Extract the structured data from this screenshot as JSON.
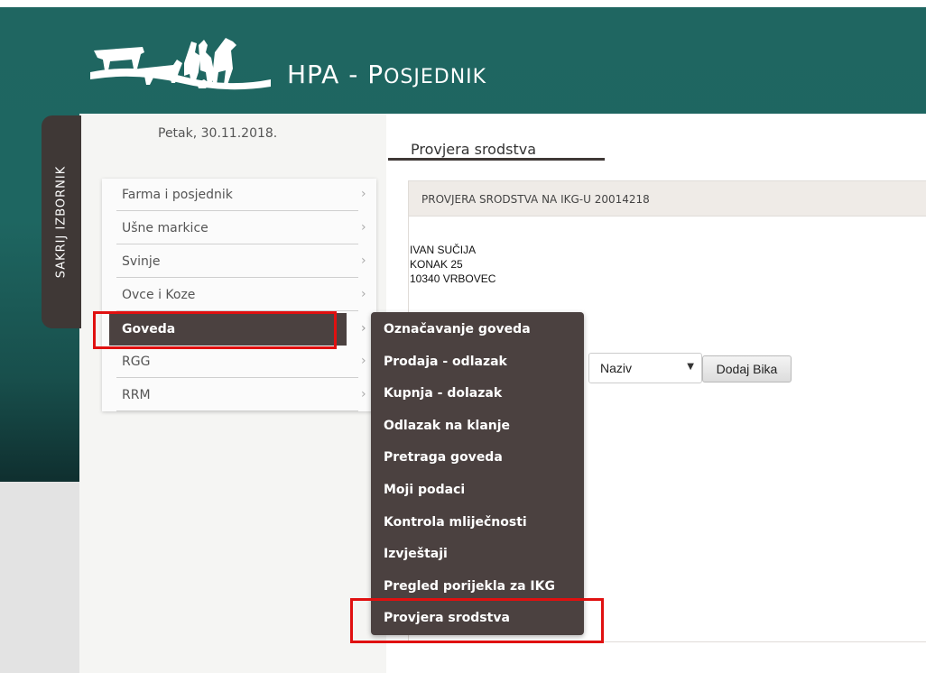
{
  "header": {
    "title_first": "HPA - ",
    "title_cap": "P",
    "title_rest": "OSJEDNIK"
  },
  "sidebar_toggle": {
    "label": "SAKRIJ IZBORNIK"
  },
  "date": "Petak, 30.11.2018.",
  "menu": {
    "items": [
      {
        "label": "Farma i posjednik"
      },
      {
        "label": "Ušne markice"
      },
      {
        "label": "Svinje"
      },
      {
        "label": "Ovce i Koze"
      },
      {
        "label": "Goveda",
        "active": true
      },
      {
        "label": "RGG"
      },
      {
        "label": "RRM"
      }
    ],
    "chevron": "›"
  },
  "submenu": {
    "items": [
      {
        "label": "Označavanje goveda"
      },
      {
        "label": "Prodaja - odlazak"
      },
      {
        "label": "Kupnja - dolazak"
      },
      {
        "label": "Odlazak na klanje"
      },
      {
        "label": "Pretraga goveda"
      },
      {
        "label": "Moji podaci"
      },
      {
        "label": "Kontrola mliječnosti"
      },
      {
        "label": "Izvještaji"
      },
      {
        "label": "Pregled porijekla za IKG"
      },
      {
        "label": "Provjera srodstva"
      }
    ]
  },
  "main": {
    "tab": "Provjera srodstva",
    "panel_title": "PROVJERA SRODSTVA NA IKG-U 20014218",
    "address": [
      "IVAN SUČIJA",
      "KONAK 25",
      "10340 VRBOVEC"
    ],
    "select": {
      "value": "Naziv",
      "arrow": "▼"
    },
    "add_button": "Dodaj Bika"
  },
  "colors": {
    "header_bg": "#1f6661",
    "menu_active": "#4b4140",
    "highlight": "#e01010"
  }
}
